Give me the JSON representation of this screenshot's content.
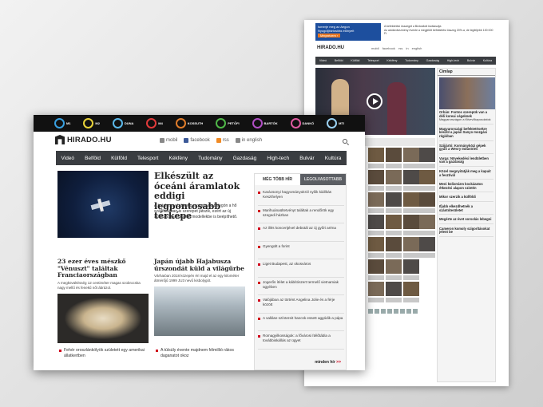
{
  "back": {
    "ad": {
      "line1": "Ismerje meg az Aegon",
      "line2": "Nyugdíjbiztosítás elönyeit",
      "button": "Megnézem ›",
      "side_line1": "A befektetési összeget a Biztosított kiválasztja",
      "side_line2": "Az adókedvezmény évente a megjelölt befektetési összeg 20%-a, de legfeljebb 100 000 Ft"
    },
    "logo": "HIRADO.HU",
    "links": "mobil  facebook  rss  in english",
    "nav": [
      "Videó",
      "Belföld",
      "Külföld",
      "Telesport",
      "Kékfény",
      "Tudomány",
      "Gazdaság",
      "High-tech",
      "Bulvár",
      "Kultúra"
    ],
    "videolist_label": "Hírbliss",
    "side_title": "Címlap",
    "side_items": [
      {
        "title": "Orbán: Fontos szerepük van a déli koreai cégeknek",
        "text": "Magyarországon a fölvevőkapcsolatok"
      },
      {
        "title": "Magyarországi befektetésekre készül a japán Sanyo mozgási régióban",
        "text": ""
      },
      {
        "title": "Szijjártó: Kormányközi gépek gyári a Wesry Industries",
        "text": ""
      },
      {
        "title": "Varga: Növekedési lendületben van a gazdaság",
        "text": ""
      },
      {
        "title": "Közel megnyitatják meg a kapuit a fesztivál",
        "text": ""
      },
      {
        "title": "Meni külismizm kockázatos étkezési alapon szintén",
        "text": ""
      },
      {
        "title": "Mikor szerzik a külföldi",
        "text": ""
      },
      {
        "title": "Ifjabb elkezdhetnék a szántóterületet",
        "text": ""
      },
      {
        "title": "Megérte az évet sorsolás lebegni",
        "text": ""
      },
      {
        "title": "Cameron komoly szigorításokat jelent be",
        "text": ""
      }
    ]
  },
  "front": {
    "channels": [
      "M1",
      "M2",
      "DUNA",
      "M4",
      "KOSSUTH",
      "PETŐFI",
      "BARTÓK",
      "DANKÓ",
      "MTI"
    ],
    "channel_colors": [
      "#39a0e0",
      "#e8d23a",
      "#5bb8e8",
      "#e03a3a",
      "#e07c2a",
      "#4fb848",
      "#b04ec4",
      "#e05aa0",
      "#9ad0f0"
    ],
    "logo": "HIRADO.HU",
    "toplinks": {
      "mobile": "mobil",
      "facebook": "facebook",
      "rss": "rss",
      "english": "in english"
    },
    "nav": [
      "Videó",
      "Belföld",
      "Külföld",
      "Telesport",
      "Kékfény",
      "Tudomány",
      "Gazdaság",
      "High-tech",
      "Bulvár",
      "Kultúra"
    ],
    "lead": {
      "title": "Elkészült az óceáni áramlatok eddigi legpontosabb térképe",
      "text": "A hatalmas vízitömeg mozgása a bolygón a hő szállításában is szerepet játszik, ezért az új szimulációs éghajlati modellekbe is beépíthető."
    },
    "cards": [
      {
        "title": "23 ezer éves mészkő \"Vénuszt\" találtak Franciaországban",
        "desc": "A megkövültésség 12 centiméter magas szobrocska nagy mellű és fenekű nőt ábrázol."
      },
      {
        "title": "Japán újabb Hajabusza űrszondát küld a világűrbe",
        "desc": "Várhatóan 2018 közepén éri majd el az egy kilométer átmérőjű 1999 JU3 nevű kisbolygót."
      }
    ],
    "bullets": [
      "Fehér oroszlánkölyök született egy amerikai állatkertben",
      "A túlsúly évente majdnem félmillió rákos daganatot okoz"
    ],
    "tabs": {
      "active": "MÉG TÖBB HÍR",
      "inactive": "LEGOLVASOTTABB"
    },
    "news": [
      "Karácsonyi hagyományokról nyílik kiállítás Keszthelyen",
      "Marihuánaültetvényt találtak a rendőrök egy szegedi házban",
      "Az illés koncertjével debütál az új győri aréna",
      "Gyengült a forint",
      "Liget Budapest, az okosváros",
      "Jogerős ítélet a kábítószert termelő vietnamiak ügyében",
      "Valójában az történt Angelina Jolie és a férje között",
      "A valláse színtereit hancsk essett aggódik a pápa",
      "Romagyilkosságok: a fővárosi Ítélőtábla a továbbiskállás az ügyet"
    ],
    "more": "minden hír",
    "more_arrows": ">>"
  }
}
